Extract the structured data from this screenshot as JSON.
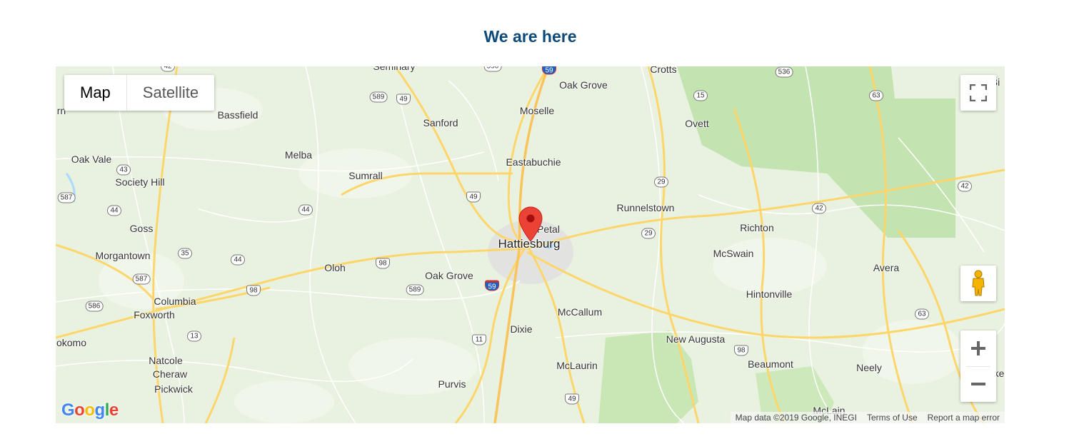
{
  "section": {
    "title": "We are here"
  },
  "map": {
    "type_control": {
      "map_label": "Map",
      "satellite_label": "Satellite",
      "selected": "Map"
    },
    "marker": {
      "label": "Hattiesburg"
    },
    "places": [
      {
        "name": "Seminary",
        "cls": ""
      },
      {
        "name": "Oak Grove",
        "cls": ""
      },
      {
        "name": "Crotts",
        "cls": ""
      },
      {
        "name": "Bassfield",
        "cls": ""
      },
      {
        "name": "Moselle",
        "cls": ""
      },
      {
        "name": "Sanford",
        "cls": ""
      },
      {
        "name": "Ovett",
        "cls": ""
      },
      {
        "name": "Melba",
        "cls": ""
      },
      {
        "name": "Oak Vale",
        "cls": ""
      },
      {
        "name": "Eastabuchie",
        "cls": ""
      },
      {
        "name": "Sumrall",
        "cls": ""
      },
      {
        "name": "Society Hill",
        "cls": ""
      },
      {
        "name": "Runnelstown",
        "cls": ""
      },
      {
        "name": "Goss",
        "cls": ""
      },
      {
        "name": "Petal",
        "cls": ""
      },
      {
        "name": "Richton",
        "cls": ""
      },
      {
        "name": "Hattiesburg",
        "cls": "city"
      },
      {
        "name": "Morgantown",
        "cls": ""
      },
      {
        "name": "McSwain",
        "cls": ""
      },
      {
        "name": "Oloh",
        "cls": ""
      },
      {
        "name": "Oak Grove",
        "cls": ""
      },
      {
        "name": "Avera",
        "cls": ""
      },
      {
        "name": "Hintonville",
        "cls": ""
      },
      {
        "name": "Columbia",
        "cls": ""
      },
      {
        "name": "Foxworth",
        "cls": ""
      },
      {
        "name": "McCallum",
        "cls": ""
      },
      {
        "name": "Dixie",
        "cls": ""
      },
      {
        "name": "New Augusta",
        "cls": ""
      },
      {
        "name": "okomo",
        "cls": ""
      },
      {
        "name": "Beaumont",
        "cls": ""
      },
      {
        "name": "Natcole",
        "cls": ""
      },
      {
        "name": "Neely",
        "cls": ""
      },
      {
        "name": "Cheraw",
        "cls": ""
      },
      {
        "name": "McLaurin",
        "cls": ""
      },
      {
        "name": "Purvis",
        "cls": ""
      },
      {
        "name": "Pickwick",
        "cls": ""
      },
      {
        "name": "McLain",
        "cls": ""
      },
      {
        "name": "rn",
        "cls": ""
      },
      {
        "name": "Bi",
        "cls": ""
      },
      {
        "name": "ke",
        "cls": ""
      }
    ],
    "shields": [
      {
        "text": "42",
        "kind": "state"
      },
      {
        "text": "590",
        "kind": "state"
      },
      {
        "text": "59",
        "kind": "inter"
      },
      {
        "text": "536",
        "kind": "state"
      },
      {
        "text": "589",
        "kind": "state"
      },
      {
        "text": "49",
        "kind": "us"
      },
      {
        "text": "15",
        "kind": "state"
      },
      {
        "text": "63",
        "kind": "state"
      },
      {
        "text": "43",
        "kind": "state"
      },
      {
        "text": "587",
        "kind": "state"
      },
      {
        "text": "44",
        "kind": "state"
      },
      {
        "text": "44",
        "kind": "state"
      },
      {
        "text": "49",
        "kind": "us"
      },
      {
        "text": "29",
        "kind": "state"
      },
      {
        "text": "42",
        "kind": "state"
      },
      {
        "text": "42",
        "kind": "state"
      },
      {
        "text": "29",
        "kind": "state"
      },
      {
        "text": "35",
        "kind": "state"
      },
      {
        "text": "44",
        "kind": "state"
      },
      {
        "text": "98",
        "kind": "us"
      },
      {
        "text": "587",
        "kind": "state"
      },
      {
        "text": "98",
        "kind": "us"
      },
      {
        "text": "589",
        "kind": "state"
      },
      {
        "text": "59",
        "kind": "inter"
      },
      {
        "text": "586",
        "kind": "state"
      },
      {
        "text": "63",
        "kind": "state"
      },
      {
        "text": "13",
        "kind": "state"
      },
      {
        "text": "11",
        "kind": "us"
      },
      {
        "text": "98",
        "kind": "us"
      },
      {
        "text": "49",
        "kind": "us"
      }
    ],
    "footer": {
      "data": "Map data ©2019 Google, INEGI",
      "terms": "Terms of Use",
      "report": "Report a map error"
    },
    "logo": "Google",
    "colors": {
      "marker": "#ea4335",
      "highway": "#fdd66b",
      "water": "#aadaff",
      "forest": "#c8e6b8",
      "urban": "#e4e4e4"
    }
  }
}
